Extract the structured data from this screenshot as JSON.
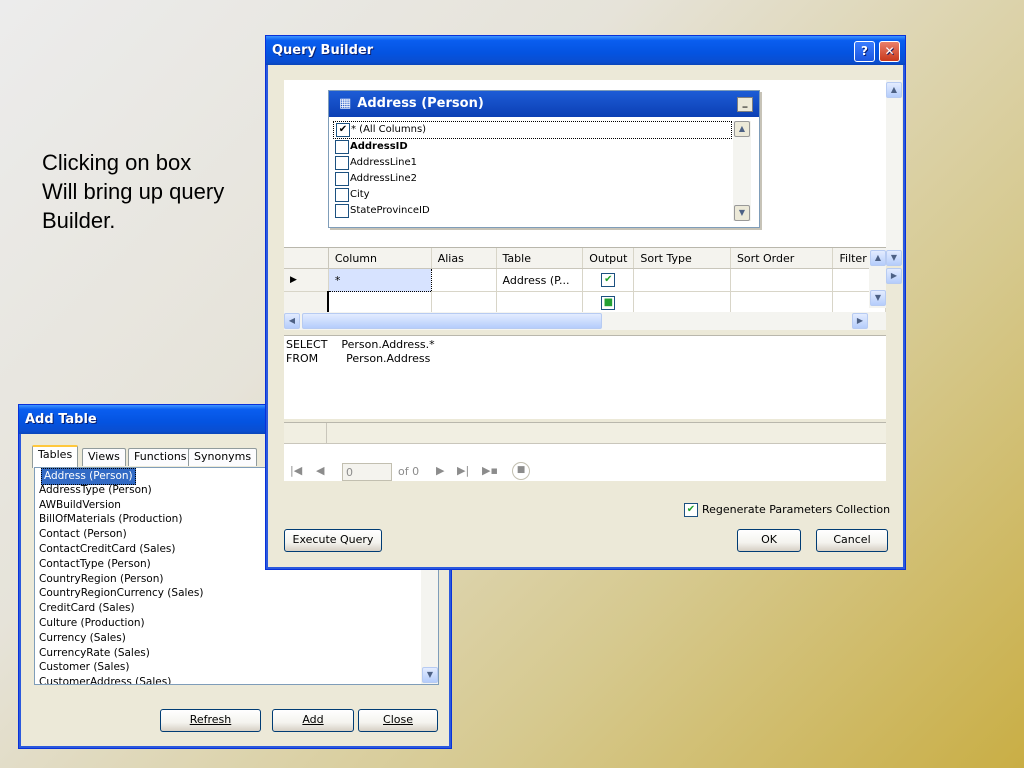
{
  "caption": {
    "line1": "Clicking on box",
    "line2": "Will bring up query",
    "line3": "Builder."
  },
  "query_builder": {
    "title": "Query Builder",
    "help_label": "?",
    "close_label": "✕",
    "table_box": {
      "title": "Address (Person)",
      "columns": [
        {
          "label": "* (All Columns)",
          "checked": true
        },
        {
          "label": "AddressID",
          "checked": false,
          "bold": true
        },
        {
          "label": "AddressLine1",
          "checked": false
        },
        {
          "label": "AddressLine2",
          "checked": false
        },
        {
          "label": "City",
          "checked": false
        },
        {
          "label": "StateProvinceID",
          "checked": false
        }
      ]
    },
    "grid": {
      "headers": [
        "Column",
        "Alias",
        "Table",
        "Output",
        "Sort Type",
        "Sort Order",
        "Filter"
      ],
      "rows": [
        {
          "column": "*",
          "alias": "",
          "table": "Address (P...",
          "output": "checked"
        },
        {
          "column": "",
          "alias": "",
          "table": "",
          "output": "indeterminate"
        }
      ]
    },
    "sql": {
      "line1": "SELECT    Person.Address.*",
      "line2": "FROM        Person.Address"
    },
    "navigator": {
      "position": "0",
      "of_label": "of 0"
    },
    "regenerate_label": "Regenerate Parameters Collection",
    "regenerate_checked": true,
    "execute_label": "Execute Query",
    "ok_label": "OK",
    "cancel_label": "Cancel"
  },
  "add_table": {
    "title": "Add Table",
    "tabs": [
      "Tables",
      "Views",
      "Functions",
      "Synonyms"
    ],
    "active_tab": "Tables",
    "items": [
      "Address (Person)",
      "AddressType (Person)",
      "AWBuildVersion",
      "BillOfMaterials (Production)",
      "Contact (Person)",
      "ContactCreditCard (Sales)",
      "ContactType (Person)",
      "CountryRegion (Person)",
      "CountryRegionCurrency (Sales)",
      "CreditCard (Sales)",
      "Culture (Production)",
      "Currency (Sales)",
      "CurrencyRate (Sales)",
      "Customer (Sales)",
      "CustomerAddress (Sales)"
    ],
    "selected_item": "Address (Person)",
    "refresh_label": "Refresh",
    "add_label": "Add",
    "close_label": "Close"
  },
  "colors": {
    "title_bar": "#0453e0",
    "selection": "#316ac5",
    "window_face": "#ece9d8"
  }
}
